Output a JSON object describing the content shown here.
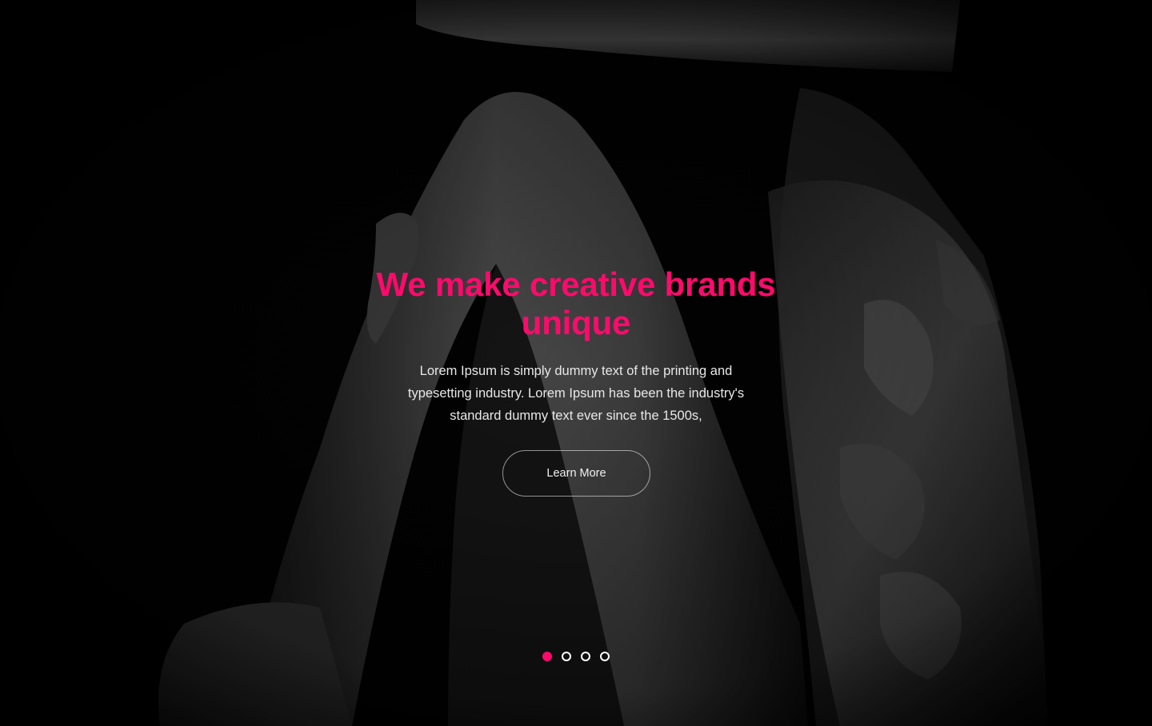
{
  "hero": {
    "headline": "We make creative brands unique",
    "description": "Lorem Ipsum is simply dummy text of the printing and typesetting industry. Lorem Ipsum has been the industry's standard dummy text ever since the 1500s,",
    "cta_label": "Learn More"
  },
  "slider": {
    "slide_count": 4,
    "active_index": 0
  },
  "colors": {
    "accent": "#ff0a6c",
    "background": "#000000",
    "text": "#e8e8e8"
  },
  "icons": {
    "background_image": "black-and-white-photo"
  }
}
